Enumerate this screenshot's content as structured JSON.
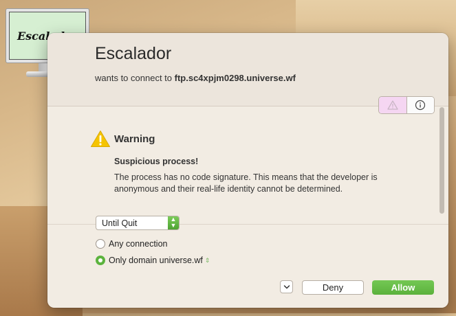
{
  "app": {
    "name": "Escalador",
    "icon_label": "Escalador"
  },
  "dialog": {
    "title": "Escalador",
    "subtitle_prefix": "wants to connect to ",
    "host": "ftp.sc4xpjm0298.universe.wf",
    "info_segments": [
      "warning-icon",
      "info-icon"
    ]
  },
  "warning": {
    "title": "Warning",
    "heading": "Suspicious process!",
    "body": "The process has no code signature. This means that the developer is anonymous and their real-life identity cannot be determined."
  },
  "duration": {
    "selected": "Until Quit"
  },
  "scope": {
    "options": [
      {
        "label": "Any connection",
        "selected": false
      },
      {
        "label": "Only domain universe.wf",
        "selected": true
      }
    ]
  },
  "buttons": {
    "deny": "Deny",
    "allow": "Allow"
  },
  "colors": {
    "accent_green": "#5bb13c",
    "warning_yellow": "#f5c400",
    "segment_pink": "#f5d6f2"
  }
}
